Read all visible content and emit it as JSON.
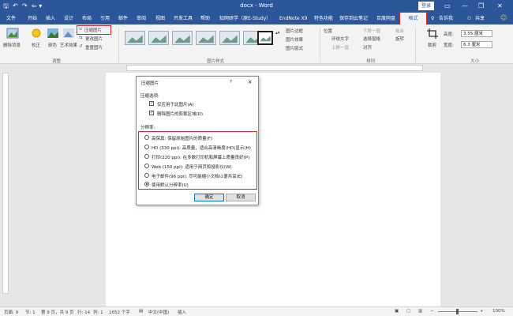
{
  "titlebar": {
    "doc_title": "docx - Word",
    "login": "登录",
    "qa_save": "🖫",
    "qa_undo": "↶",
    "qa_redo": "↷",
    "qa_more": "⇐ ▾",
    "min": "—",
    "restore": "❐",
    "close": "✕"
  },
  "tabs": [
    "文件",
    "开始",
    "插入",
    "设计",
    "布局",
    "引用",
    "邮件",
    "审阅",
    "视图",
    "开发工具",
    "帮助",
    "知网研学（原E-Study）",
    "EndNote X9",
    "特色功能",
    "保存到云笔记",
    "百度网盘",
    "格式"
  ],
  "tabbar_right": {
    "tell_me": "告诉我",
    "share": "共享"
  },
  "ribbon": {
    "remove_bg": "删除背景",
    "correct": "校正",
    "color": "颜色",
    "art_effect": "艺术效果",
    "compress": "压缩图片",
    "change_pic": "更改图片",
    "reset_pic": "重置图片",
    "adjust_group": "调整",
    "styles_group": "图片样式",
    "pic_border": "图片边框",
    "pic_effect": "图片效果",
    "pic_layout": "图片版式",
    "position": "位置",
    "wrap_text": "环绕文字",
    "bring_forward": "上移一层",
    "send_backward": "下移一层",
    "select_pane": "选择窗格",
    "align": "对齐",
    "group": "组合",
    "rotate": "旋转",
    "arrange_group": "排列",
    "crop": "裁剪",
    "height_label": "高度:",
    "height_value": "3.55 厘米",
    "width_label": "宽度:",
    "width_value": "6.3 厘米",
    "size_group": "大小"
  },
  "dialog": {
    "title": "压缩图片",
    "help": "?",
    "close": "✕",
    "compress_options": "压缩选项:",
    "opt_apply_only": "仅应用于此图片(A)",
    "opt_delete_crop": "删除图片的剪裁区域(D)",
    "resolution": "分辨率:",
    "radios": [
      "高保真: 保留原始图片的质量(F)",
      "HD (330 ppi): 高质量，适合高清晰度(HD)显示(H)",
      "打印(220 ppi): 在多数打印机和屏幕上质量良好(P)",
      "Web (150 ppi): 适用于网页和投影仪(W)",
      "电子邮件(96 ppi): 尽可能缩小文档以便共享(E)",
      "使用默认分辨率(U)"
    ],
    "selected_index": 5,
    "ok": "确定",
    "cancel": "取消"
  },
  "status": {
    "page": "页面: 9",
    "section": "节: 1",
    "page_of": "第 9 页，共 9 页",
    "row": "行: 14",
    "col": "列: 1",
    "words": "1652 个字",
    "lang": "中文(中国)",
    "mode": "插入",
    "zoom": "100%",
    "zoom_minus": "−",
    "zoom_plus": "+"
  },
  "colors": {
    "accent": "#2b579a",
    "highlight": "#d9232e"
  }
}
